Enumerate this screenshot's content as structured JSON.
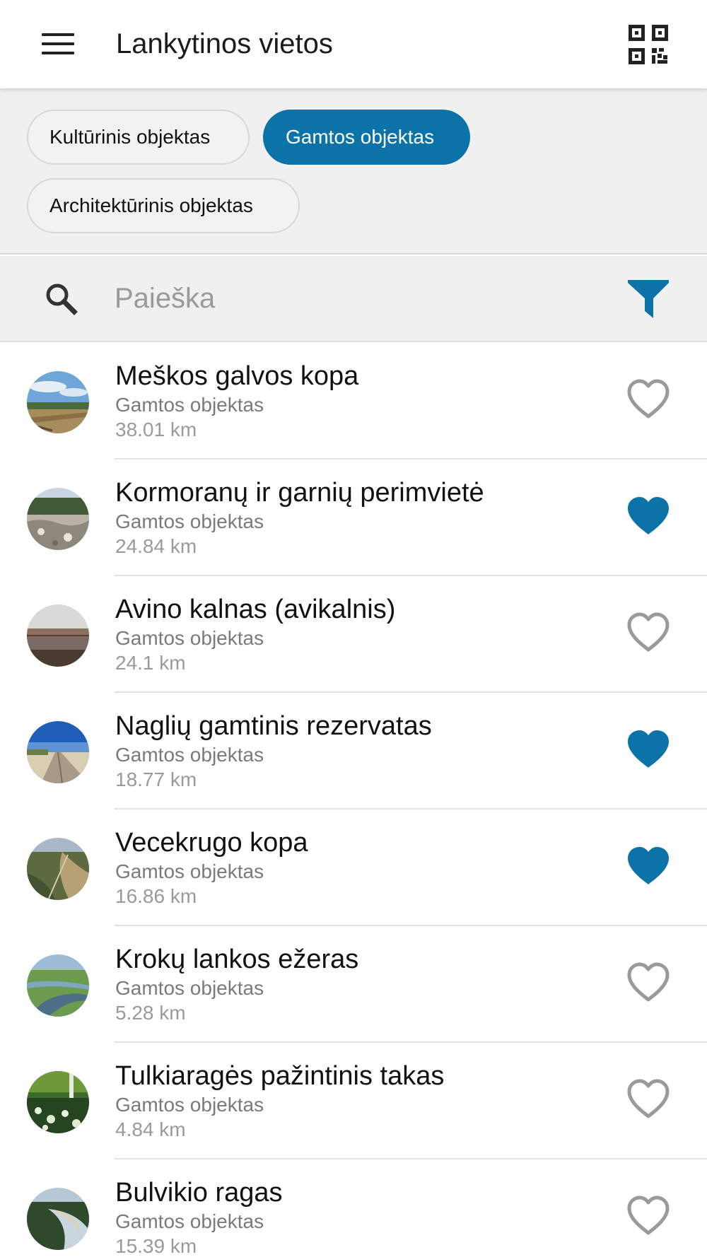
{
  "app_bar": {
    "title": "Lankytinos vietos"
  },
  "chips": [
    {
      "label": "Kultūrinis objektas",
      "active": false
    },
    {
      "label": "Gamtos objektas",
      "active": true
    },
    {
      "label": "Architektūrinis objektas",
      "active": false
    }
  ],
  "search": {
    "placeholder": "Paieška"
  },
  "colors": {
    "accent": "#0b73a8",
    "heart_outline": "#9a9a9a"
  },
  "places": [
    {
      "name": "Meškos galvos kopa",
      "category": "Gamtos objektas",
      "distance": "38.01 km",
      "favorite": false
    },
    {
      "name": "Kormoranų ir garnių perimvietė",
      "category": "Gamtos objektas",
      "distance": "24.84 km",
      "favorite": true
    },
    {
      "name": "Avino kalnas (avikalnis)",
      "category": "Gamtos objektas",
      "distance": "24.1 km",
      "favorite": false
    },
    {
      "name": "Naglių gamtinis rezervatas",
      "category": "Gamtos objektas",
      "distance": "18.77 km",
      "favorite": true
    },
    {
      "name": "Vecekrugo kopa",
      "category": "Gamtos objektas",
      "distance": "16.86 km",
      "favorite": true
    },
    {
      "name": "Krokų lankos ežeras",
      "category": "Gamtos objektas",
      "distance": "5.28 km",
      "favorite": false
    },
    {
      "name": "Tulkiaragės pažintinis takas",
      "category": "Gamtos objektas",
      "distance": "4.84 km",
      "favorite": false
    },
    {
      "name": "Bulvikio ragas",
      "category": "Gamtos objektas",
      "distance": "15.39 km",
      "favorite": false
    }
  ]
}
